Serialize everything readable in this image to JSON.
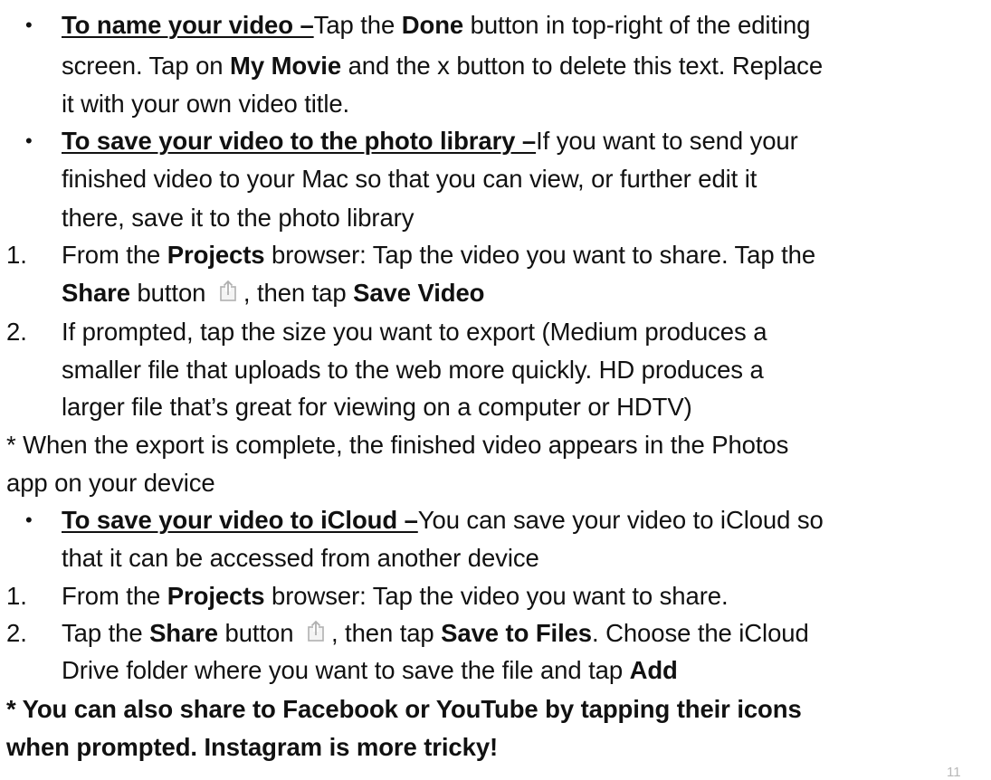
{
  "sections": {
    "name": {
      "heading": "To name your video –",
      "l1": "Tap the ",
      "done": "Done",
      "l1b": " button in top-right of the editing",
      "l2a": "screen. Tap on ",
      "mymovie": "My Movie",
      "l2b": " and the x button to delete this text. Replace",
      "l3": "it with your own video title."
    },
    "library": {
      "heading": "To save your video to the photo library –",
      "l1": "If you want to send your",
      "l2": "finished video to your Mac so that you can view, or further edit it",
      "l3": "there, save it to the photo library",
      "step1": {
        "num": "1.",
        "a": "From the ",
        "projects": "Projects",
        "b": " browser: Tap the video you want to share. Tap the",
        "share": "Share",
        "c": " button ",
        "d": ", then tap ",
        "save": "Save Video"
      },
      "step2": {
        "num": "2.",
        "l1": "If prompted, tap the size you want to export (Medium produces a",
        "l2": "smaller file that uploads to the web more quickly. HD produces a",
        "l3": "larger file that’s great for viewing on a computer or HDTV)"
      },
      "note_l1": "* When the export is complete, the finished video appears in the Photos",
      "note_l2": "app on your device"
    },
    "icloud": {
      "heading": "To save your video to iCloud –",
      "l1": "You can save your video to iCloud so",
      "l2": "that it can be accessed from another device",
      "step1": {
        "num": "1.",
        "a": "From the ",
        "projects": "Projects",
        "b": " browser: Tap the video you want to share."
      },
      "step2": {
        "num": "2.",
        "a": "Tap the ",
        "share": "Share",
        "b": " button ",
        "c": ", then tap ",
        "savefiles": "Save to Files",
        "d": ". Choose the iCloud",
        "l2a": "Drive folder where you want to save the file and tap ",
        "add": "Add"
      }
    }
  },
  "final_note": {
    "l1": "* You can also share to Facebook or YouTube by tapping their icons",
    "l2": "when prompted. Instagram is more tricky!"
  },
  "bullet_symbol": "•",
  "page_number": "11",
  "icons": {
    "share": "share-icon"
  }
}
